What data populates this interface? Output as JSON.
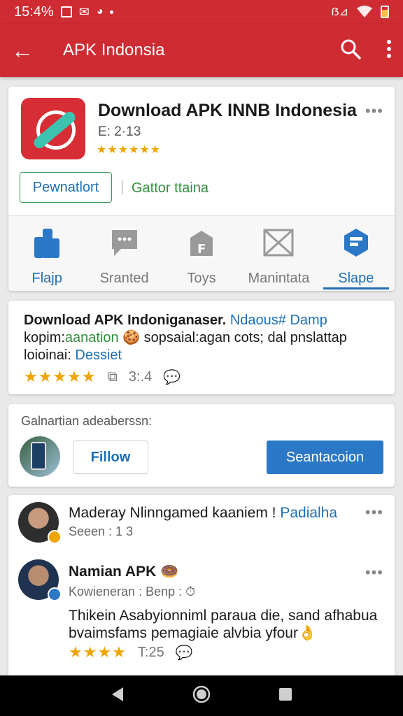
{
  "status": {
    "time": "15:4%",
    "right_text": "ẞ⊿"
  },
  "appbar": {
    "title": "APK Indonsia"
  },
  "app": {
    "title": "Download APK INNB Indonesia",
    "meta": "E: 2·13",
    "stars": "★★★★★★",
    "install_label": "Pewnatlort",
    "secondary_link": "Gattor ttaina",
    "tabs": [
      {
        "label": "Flajp"
      },
      {
        "label": "Sranted"
      },
      {
        "label": "Toys"
      },
      {
        "label": "Manintata"
      },
      {
        "label": "Slape"
      }
    ]
  },
  "post": {
    "line1_bold": "Download APK Indoniganaser.",
    "line1_blue": " Ndaous# Damp",
    "line2_a": "kopim:",
    "line2_green": "aanation",
    "line2_b": " 🍪 sopsaial:agan cots; dal pnslattap",
    "line3_a": "loioinai:",
    "line3_blue": " Dessiet",
    "stars": "★★★★★",
    "count": "3:.4"
  },
  "suggest": {
    "label": "Galnartian adeaberssn:",
    "follow_label": "Fillow",
    "primary_label": "Seantacoion"
  },
  "comments": [
    {
      "name": "Maderay Nlinngamed kaaniem !",
      "name_link": "Padialha",
      "sub": "Seeen : 1 3"
    },
    {
      "name": "Namian APK 🍩",
      "sub": "Kowieneran : Benp : ⏱",
      "body": "Thikein Asabyionniml paraua die, sand afhabua bvaimsfams pemagiaie alvbia yfour👌",
      "stars": "★★★★",
      "count": "T:25"
    }
  ],
  "colors": {
    "brand": "#cf2b33",
    "accent": "#1e6fb5",
    "star": "#f0a400",
    "green": "#2f8f3b"
  }
}
